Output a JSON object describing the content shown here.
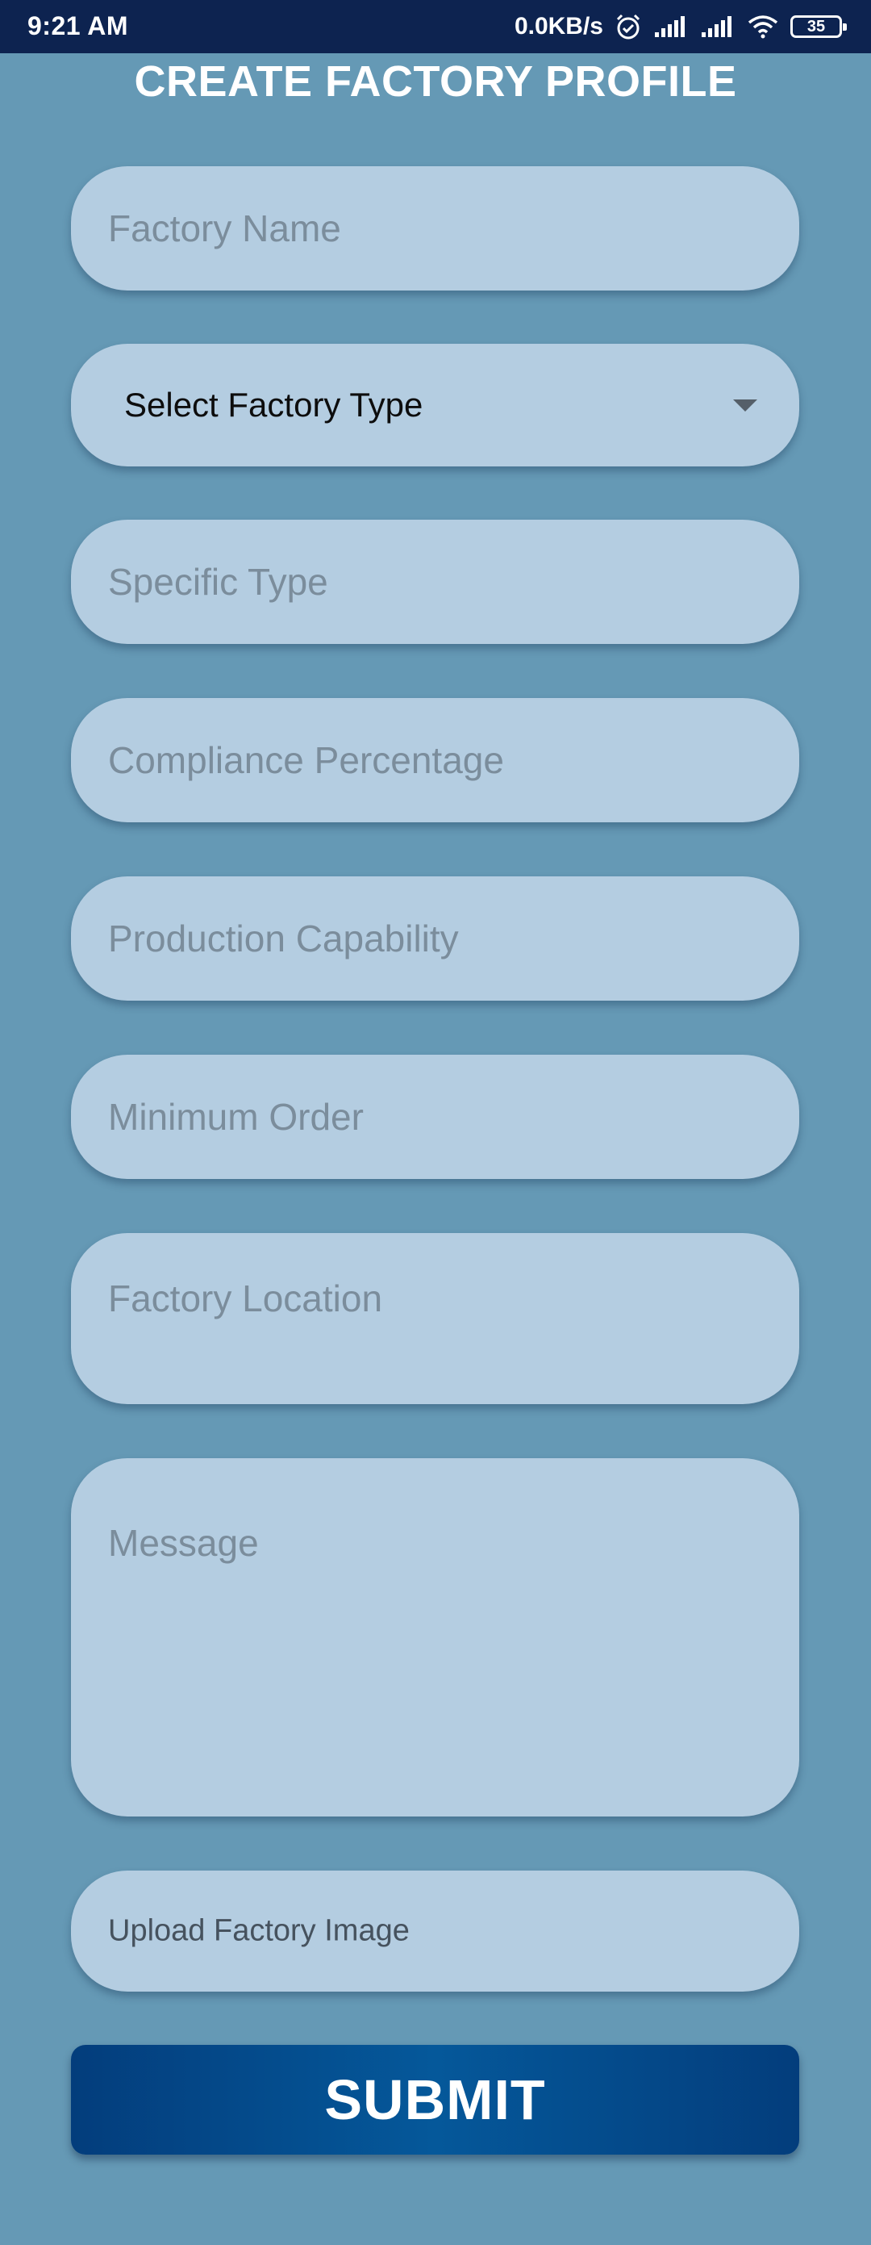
{
  "status_bar": {
    "time": "9:21 AM",
    "network_speed": "0.0KB/s",
    "battery_level": "35",
    "icons": [
      "alarm-icon",
      "signal-icon",
      "signal-icon",
      "wifi-icon",
      "battery-icon"
    ]
  },
  "page_title": "CREATE FACTORY PROFILE",
  "form": {
    "factory_name": {
      "value": "",
      "placeholder": "Factory Name"
    },
    "factory_type": {
      "selected": "Select Factory Type",
      "icon": "dropdown-arrow-icon"
    },
    "specific_type": {
      "value": "",
      "placeholder": "Specific Type"
    },
    "compliance_percentage": {
      "value": "",
      "placeholder": "Compliance Percentage"
    },
    "production_capability": {
      "value": "",
      "placeholder": "Production Capability"
    },
    "minimum_order": {
      "value": "",
      "placeholder": "Minimum Order"
    },
    "factory_location": {
      "value": "",
      "placeholder": "Factory Location"
    },
    "message": {
      "value": "",
      "placeholder": "Message"
    },
    "upload_image_label": "Upload Factory Image",
    "submit_label": "SUBMIT"
  },
  "colors": {
    "background": "#6599b5",
    "status_bar": "#0d2350",
    "field": "#b4cde1",
    "placeholder": "#7b8d9c",
    "button": "#05589a"
  }
}
